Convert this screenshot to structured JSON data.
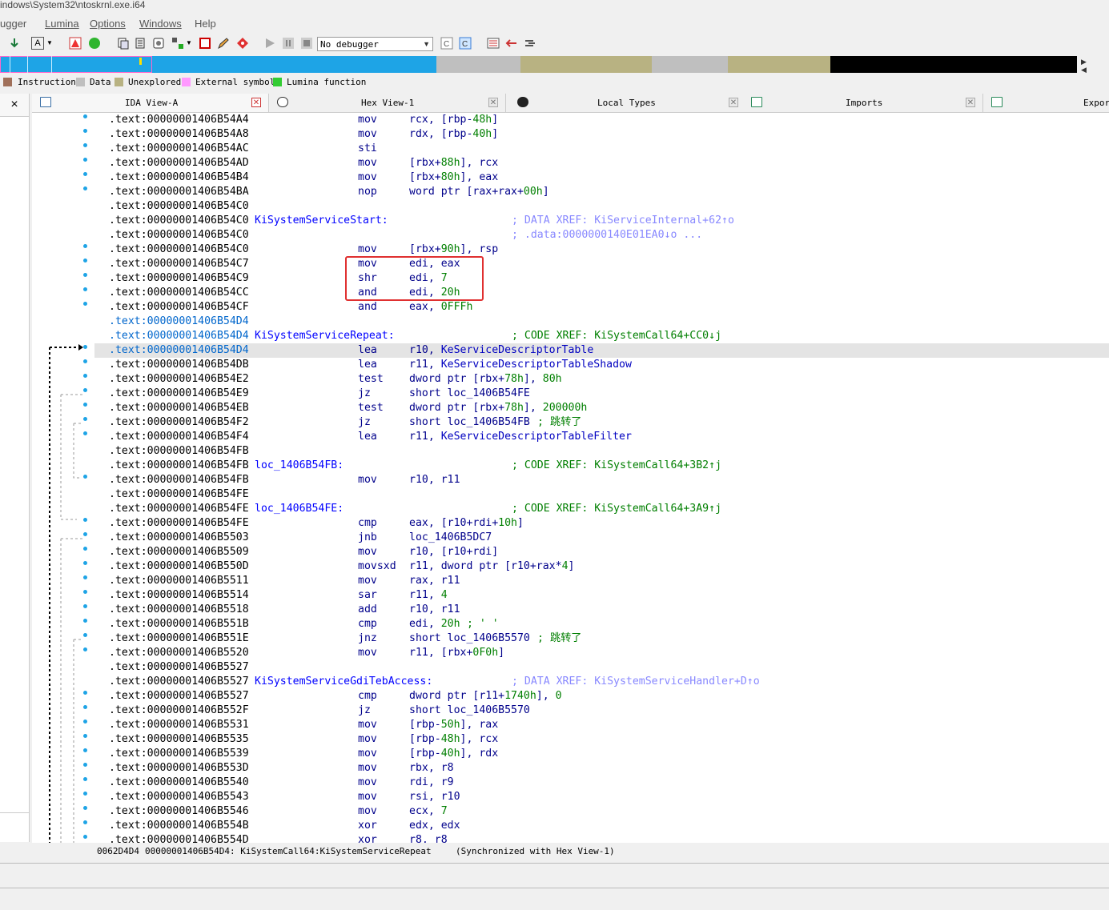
{
  "window": {
    "title": "indows\\System32\\ntoskrnl.exe.i64"
  },
  "menu": [
    "ugger",
    "Lumina",
    "Options",
    "Windows",
    "Help"
  ],
  "toolbar": {
    "debugger_select": "No debugger",
    "icons": [
      "step-into-icon",
      "font-a-icon",
      "dropdown-icon",
      "triangle-warning-icon",
      "green-circle-icon",
      "copy-icon",
      "paste-icon",
      "struct-icon",
      "layout-icon",
      "stop-square-icon",
      "pencil-edit-icon",
      "breakpoint-diamond-icon",
      "play-icon",
      "pause-icon",
      "stop-icon",
      "tracing-icon",
      "tracing-active-icon",
      "view-list-icon",
      "arrow-left-icon",
      "arrow-right-icon"
    ]
  },
  "navband": {
    "segments": [
      {
        "color": "#1ea4e6",
        "from": 0,
        "to": 0.13
      },
      {
        "color": "#1ea4e6",
        "from": 0.13,
        "to": 0.405
      },
      {
        "color": "#bfbfbf",
        "from": 0.405,
        "to": 0.483
      },
      {
        "color": "#b8b282",
        "from": 0.483,
        "to": 0.605
      },
      {
        "color": "#bfbfbf",
        "from": 0.605,
        "to": 0.676
      },
      {
        "color": "#b8b282",
        "from": 0.676,
        "to": 0.771
      },
      {
        "color": "#000000",
        "from": 0.771,
        "to": 1.0
      }
    ]
  },
  "legend": [
    {
      "label": "Instruction",
      "color": "#a0705a"
    },
    {
      "label": "Data",
      "color": "#bfbfbf"
    },
    {
      "label": "Unexplored",
      "color": "#b8b282"
    },
    {
      "label": "External symbol",
      "color": "#ff99ff"
    },
    {
      "label": "Lumina function",
      "color": "#33cc33"
    }
  ],
  "leftpanel": {
    "close": "×"
  },
  "tabs": [
    {
      "label": "IDA View-A",
      "close_icon": "red-close-icon",
      "active": true
    },
    {
      "label": "Hex View-1",
      "close_icon": "close-icon",
      "active": false
    },
    {
      "label": "Local Types",
      "close_icon": "close-icon",
      "active": false
    },
    {
      "label": "Imports",
      "close_icon": "close-icon",
      "active": false
    },
    {
      "label": "Expor",
      "close_icon": "",
      "active": false
    }
  ],
  "disasm": [
    {
      "addr": ".text:00000001406B54A4",
      "label": "",
      "mnem": "mov",
      "ops": "rcx, [rbp-48h]",
      "cmt": "",
      "dot": true
    },
    {
      "addr": ".text:00000001406B54A8",
      "label": "",
      "mnem": "mov",
      "ops": "rdx, [rbp-40h]",
      "cmt": "",
      "dot": true
    },
    {
      "addr": ".text:00000001406B54AC",
      "label": "",
      "mnem": "sti",
      "ops": "",
      "cmt": "",
      "dot": true
    },
    {
      "addr": ".text:00000001406B54AD",
      "label": "",
      "mnem": "mov",
      "ops": "[rbx+88h], rcx",
      "cmt": "",
      "dot": true
    },
    {
      "addr": ".text:00000001406B54B4",
      "label": "",
      "mnem": "mov",
      "ops": "[rbx+80h], eax",
      "cmt": "",
      "dot": true
    },
    {
      "addr": ".text:00000001406B54BA",
      "label": "",
      "mnem": "nop",
      "ops": "word ptr [rax+rax+00h]",
      "cmt": "",
      "dot": true
    },
    {
      "addr": ".text:00000001406B54C0",
      "label": "",
      "mnem": "",
      "ops": "",
      "cmt": "",
      "dot": false
    },
    {
      "addr": ".text:00000001406B54C0",
      "label": "KiSystemServiceStart:",
      "mnem": "",
      "ops": "",
      "cmt": "; DATA XREF: KiServiceInternal+62↑o",
      "cmt_gray": true,
      "dot": false
    },
    {
      "addr": ".text:00000001406B54C0",
      "label": "",
      "mnem": "",
      "ops": "",
      "cmt": "; .data:0000000140E01EA0↓o ...",
      "cmt_gray": true,
      "dot": false
    },
    {
      "addr": ".text:00000001406B54C0",
      "label": "",
      "mnem": "mov",
      "ops": "[rbx+90h], rsp",
      "cmt": "",
      "dot": true
    },
    {
      "addr": ".text:00000001406B54C7",
      "label": "",
      "mnem": "mov",
      "ops": "edi, eax",
      "cmt": "",
      "dot": true
    },
    {
      "addr": ".text:00000001406B54C9",
      "label": "",
      "mnem": "shr",
      "ops": "edi, 7",
      "cmt": "",
      "dot": true
    },
    {
      "addr": ".text:00000001406B54CC",
      "label": "",
      "mnem": "and",
      "ops": "edi, 20h",
      "cmt": "",
      "dot": true
    },
    {
      "addr": ".text:00000001406B54CF",
      "label": "",
      "mnem": "and",
      "ops": "eax, 0FFFh",
      "cmt": "",
      "dot": true
    },
    {
      "addr": ".text:00000001406B54D4",
      "label": "",
      "mnem": "",
      "ops": "",
      "cmt": "",
      "dot": false,
      "blue": true
    },
    {
      "addr": ".text:00000001406B54D4",
      "label": "KiSystemServiceRepeat:",
      "mnem": "",
      "ops": "",
      "cmt": "; CODE XREF: KiSystemCall64+CC0↓j",
      "dot": false,
      "blue": true
    },
    {
      "addr": ".text:00000001406B54D4",
      "label": "",
      "mnem": "lea",
      "ops": "r10, KeServiceDescriptorTable",
      "cmt": "",
      "dot": true,
      "hl": true,
      "blue": true
    },
    {
      "addr": ".text:00000001406B54DB",
      "label": "",
      "mnem": "lea",
      "ops": "r11, KeServiceDescriptorTableShadow",
      "cmt": "",
      "dot": true
    },
    {
      "addr": ".text:00000001406B54E2",
      "label": "",
      "mnem": "test",
      "ops": "dword ptr [rbx+78h], 80h",
      "cmt": "",
      "dot": true
    },
    {
      "addr": ".text:00000001406B54E9",
      "label": "",
      "mnem": "jz",
      "ops": "short loc_1406B54FE",
      "cmt": "",
      "dot": true
    },
    {
      "addr": ".text:00000001406B54EB",
      "label": "",
      "mnem": "test",
      "ops": "dword ptr [rbx+78h], 200000h",
      "cmt": "",
      "dot": true
    },
    {
      "addr": ".text:00000001406B54F2",
      "label": "",
      "mnem": "jz",
      "ops": "short loc_1406B54FB",
      "cmt": "; 跳转了",
      "inline": true,
      "dot": true
    },
    {
      "addr": ".text:00000001406B54F4",
      "label": "",
      "mnem": "lea",
      "ops": "r11, KeServiceDescriptorTableFilter",
      "cmt": "",
      "dot": true
    },
    {
      "addr": ".text:00000001406B54FB",
      "label": "",
      "mnem": "",
      "ops": "",
      "cmt": "",
      "dot": false
    },
    {
      "addr": ".text:00000001406B54FB",
      "label": "loc_1406B54FB:",
      "mnem": "",
      "ops": "",
      "cmt": "; CODE XREF: KiSystemCall64+3B2↑j",
      "dot": false
    },
    {
      "addr": ".text:00000001406B54FB",
      "label": "",
      "mnem": "mov",
      "ops": "r10, r11",
      "cmt": "",
      "dot": true
    },
    {
      "addr": ".text:00000001406B54FE",
      "label": "",
      "mnem": "",
      "ops": "",
      "cmt": "",
      "dot": false
    },
    {
      "addr": ".text:00000001406B54FE",
      "label": "loc_1406B54FE:",
      "mnem": "",
      "ops": "",
      "cmt": "; CODE XREF: KiSystemCall64+3A9↑j",
      "dot": false
    },
    {
      "addr": ".text:00000001406B54FE",
      "label": "",
      "mnem": "cmp",
      "ops": "eax, [r10+rdi+10h]",
      "cmt": "",
      "dot": true
    },
    {
      "addr": ".text:00000001406B5503",
      "label": "",
      "mnem": "jnb",
      "ops": "loc_1406B5DC7",
      "cmt": "",
      "dot": true
    },
    {
      "addr": ".text:00000001406B5509",
      "label": "",
      "mnem": "mov",
      "ops": "r10, [r10+rdi]",
      "cmt": "",
      "dot": true
    },
    {
      "addr": ".text:00000001406B550D",
      "label": "",
      "mnem": "movsxd",
      "ops": "r11, dword ptr [r10+rax*4]",
      "cmt": "",
      "dot": true
    },
    {
      "addr": ".text:00000001406B5511",
      "label": "",
      "mnem": "mov",
      "ops": "rax, r11",
      "cmt": "",
      "dot": true
    },
    {
      "addr": ".text:00000001406B5514",
      "label": "",
      "mnem": "sar",
      "ops": "r11, 4",
      "cmt": "",
      "dot": true
    },
    {
      "addr": ".text:00000001406B5518",
      "label": "",
      "mnem": "add",
      "ops": "r10, r11",
      "cmt": "",
      "dot": true
    },
    {
      "addr": ".text:00000001406B551B",
      "label": "",
      "mnem": "cmp",
      "ops": "edi, 20h",
      "cmt": "; ' '",
      "inline": true,
      "dot": true
    },
    {
      "addr": ".text:00000001406B551E",
      "label": "",
      "mnem": "jnz",
      "ops": "short loc_1406B5570",
      "cmt": "; 跳转了",
      "inline": true,
      "dot": true
    },
    {
      "addr": ".text:00000001406B5520",
      "label": "",
      "mnem": "mov",
      "ops": "r11, [rbx+0F0h]",
      "cmt": "",
      "dot": true
    },
    {
      "addr": ".text:00000001406B5527",
      "label": "",
      "mnem": "",
      "ops": "",
      "cmt": "",
      "dot": false
    },
    {
      "addr": ".text:00000001406B5527",
      "label": "KiSystemServiceGdiTebAccess:",
      "mnem": "",
      "ops": "",
      "cmt": "; DATA XREF: KiSystemServiceHandler+D↑o",
      "cmt_gray": true,
      "dot": false
    },
    {
      "addr": ".text:00000001406B5527",
      "label": "",
      "mnem": "cmp",
      "ops": "dword ptr [r11+1740h], 0",
      "cmt": "",
      "dot": true
    },
    {
      "addr": ".text:00000001406B552F",
      "label": "",
      "mnem": "jz",
      "ops": "short loc_1406B5570",
      "cmt": "",
      "dot": true
    },
    {
      "addr": ".text:00000001406B5531",
      "label": "",
      "mnem": "mov",
      "ops": "[rbp-50h], rax",
      "cmt": "",
      "dot": true
    },
    {
      "addr": ".text:00000001406B5535",
      "label": "",
      "mnem": "mov",
      "ops": "[rbp-48h], rcx",
      "cmt": "",
      "dot": true
    },
    {
      "addr": ".text:00000001406B5539",
      "label": "",
      "mnem": "mov",
      "ops": "[rbp-40h], rdx",
      "cmt": "",
      "dot": true
    },
    {
      "addr": ".text:00000001406B553D",
      "label": "",
      "mnem": "mov",
      "ops": "rbx, r8",
      "cmt": "",
      "dot": true
    },
    {
      "addr": ".text:00000001406B5540",
      "label": "",
      "mnem": "mov",
      "ops": "rdi, r9",
      "cmt": "",
      "dot": true
    },
    {
      "addr": ".text:00000001406B5543",
      "label": "",
      "mnem": "mov",
      "ops": "rsi, r10",
      "cmt": "",
      "dot": true
    },
    {
      "addr": ".text:00000001406B5546",
      "label": "",
      "mnem": "mov",
      "ops": "ecx, 7",
      "cmt": "",
      "dot": true
    },
    {
      "addr": ".text:00000001406B554B",
      "label": "",
      "mnem": "xor",
      "ops": "edx, edx",
      "cmt": "",
      "dot": true
    },
    {
      "addr": ".text:00000001406B554D",
      "label": "",
      "mnem": "xor",
      "ops": "r8, r8",
      "cmt": "",
      "dot": true
    }
  ],
  "status": {
    "offset": "0062D4D4",
    "location": "00000001406B54D4: KiSystemCall64:KiSystemServiceRepeat",
    "sync": "(Synchronized with Hex View-1)"
  },
  "colors": {
    "highlight_box": "#e03030",
    "dot": "#1ea4e6",
    "mnemonic": "#00008b",
    "label": "#0000ff",
    "comment": "#007f00",
    "xref_comment": "#8888ff"
  }
}
